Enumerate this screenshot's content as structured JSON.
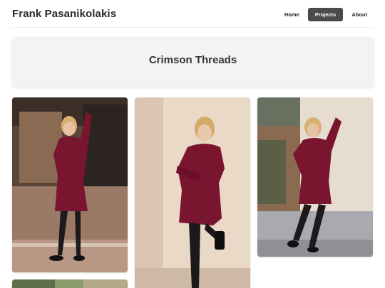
{
  "header": {
    "site_title": "Frank Pasanikolakis",
    "nav": [
      {
        "label": "Home",
        "active": false
      },
      {
        "label": "Projects",
        "active": true
      },
      {
        "label": "About",
        "active": false
      }
    ]
  },
  "hero": {
    "title": "Crimson Threads"
  },
  "gallery": {
    "photos": [
      {
        "subject": "woman in crimson dress leaning on post in arcade"
      },
      {
        "subject": "woman in crimson dress leaning on cream wall, knee raised"
      },
      {
        "subject": "woman in crimson dress against wall, hand on head"
      },
      {
        "subject": "partially visible photo"
      }
    ]
  },
  "colors": {
    "dress": "#7a1530",
    "nav_active_bg": "#4a4a4a",
    "hero_bg": "#f3f3f3"
  }
}
